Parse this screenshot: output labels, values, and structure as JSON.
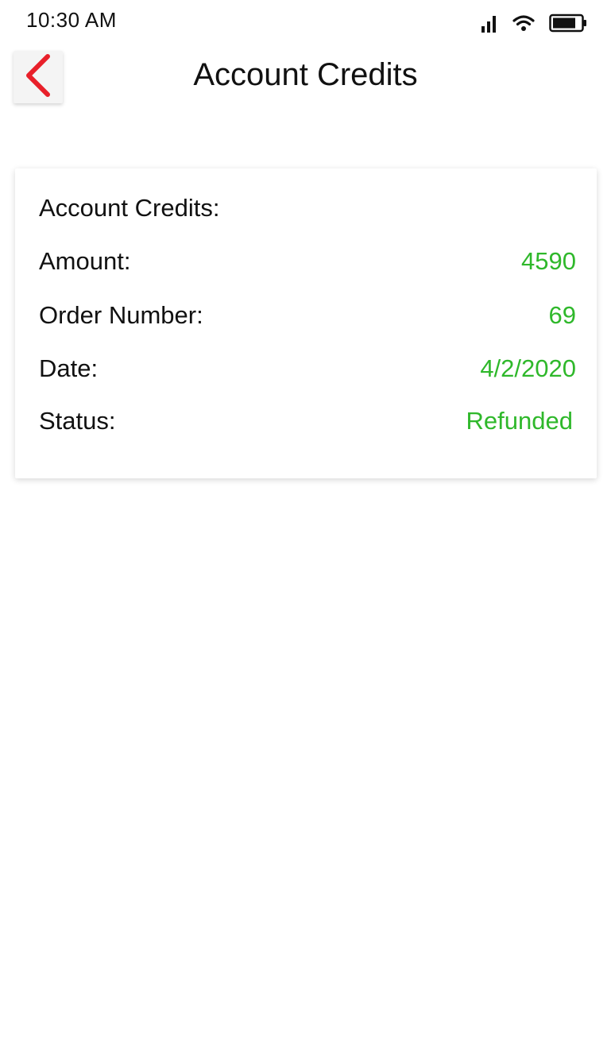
{
  "status_bar": {
    "time": "10:30 AM",
    "icons": [
      "signal-icon",
      "wifi-icon",
      "battery-icon"
    ]
  },
  "header": {
    "back_icon": "chevron-left-icon",
    "title": "Account Credits"
  },
  "card": {
    "title": "Account Credits:",
    "rows": [
      {
        "label": "Amount:",
        "value": "4590"
      },
      {
        "label": "Order Number:",
        "value": "69"
      },
      {
        "label": "Date:",
        "value": "4/2/2020"
      },
      {
        "label": "Status:",
        "value": "Refunded"
      }
    ]
  },
  "colors": {
    "accent_red": "#e8202a",
    "value_green": "#2fb82b",
    "text": "#111111",
    "background": "#ffffff"
  }
}
